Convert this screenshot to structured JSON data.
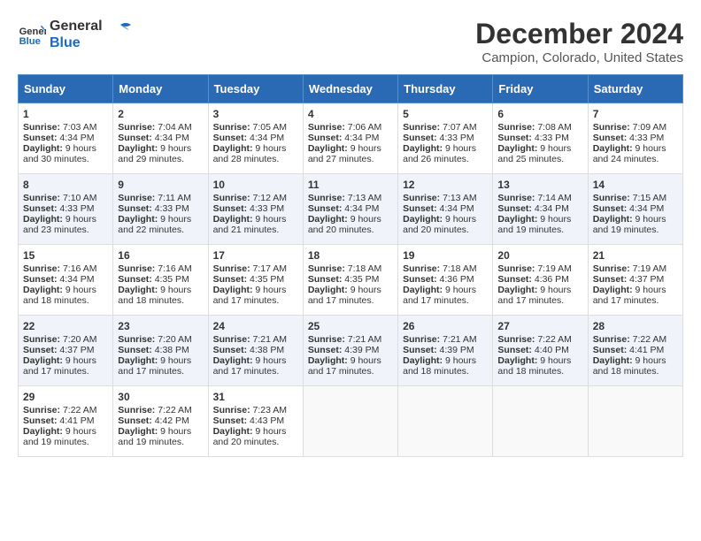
{
  "logo": {
    "line1": "General",
    "line2": "Blue"
  },
  "title": "December 2024",
  "subtitle": "Campion, Colorado, United States",
  "weekdays": [
    "Sunday",
    "Monday",
    "Tuesday",
    "Wednesday",
    "Thursday",
    "Friday",
    "Saturday"
  ],
  "weeks": [
    [
      {
        "day": 1,
        "sunrise": "7:03 AM",
        "sunset": "4:34 PM",
        "daylight": "9 hours and 30 minutes."
      },
      {
        "day": 2,
        "sunrise": "7:04 AM",
        "sunset": "4:34 PM",
        "daylight": "9 hours and 29 minutes."
      },
      {
        "day": 3,
        "sunrise": "7:05 AM",
        "sunset": "4:34 PM",
        "daylight": "9 hours and 28 minutes."
      },
      {
        "day": 4,
        "sunrise": "7:06 AM",
        "sunset": "4:34 PM",
        "daylight": "9 hours and 27 minutes."
      },
      {
        "day": 5,
        "sunrise": "7:07 AM",
        "sunset": "4:33 PM",
        "daylight": "9 hours and 26 minutes."
      },
      {
        "day": 6,
        "sunrise": "7:08 AM",
        "sunset": "4:33 PM",
        "daylight": "9 hours and 25 minutes."
      },
      {
        "day": 7,
        "sunrise": "7:09 AM",
        "sunset": "4:33 PM",
        "daylight": "9 hours and 24 minutes."
      }
    ],
    [
      {
        "day": 8,
        "sunrise": "7:10 AM",
        "sunset": "4:33 PM",
        "daylight": "9 hours and 23 minutes."
      },
      {
        "day": 9,
        "sunrise": "7:11 AM",
        "sunset": "4:33 PM",
        "daylight": "9 hours and 22 minutes."
      },
      {
        "day": 10,
        "sunrise": "7:12 AM",
        "sunset": "4:33 PM",
        "daylight": "9 hours and 21 minutes."
      },
      {
        "day": 11,
        "sunrise": "7:13 AM",
        "sunset": "4:34 PM",
        "daylight": "9 hours and 20 minutes."
      },
      {
        "day": 12,
        "sunrise": "7:13 AM",
        "sunset": "4:34 PM",
        "daylight": "9 hours and 20 minutes."
      },
      {
        "day": 13,
        "sunrise": "7:14 AM",
        "sunset": "4:34 PM",
        "daylight": "9 hours and 19 minutes."
      },
      {
        "day": 14,
        "sunrise": "7:15 AM",
        "sunset": "4:34 PM",
        "daylight": "9 hours and 19 minutes."
      }
    ],
    [
      {
        "day": 15,
        "sunrise": "7:16 AM",
        "sunset": "4:34 PM",
        "daylight": "9 hours and 18 minutes."
      },
      {
        "day": 16,
        "sunrise": "7:16 AM",
        "sunset": "4:35 PM",
        "daylight": "9 hours and 18 minutes."
      },
      {
        "day": 17,
        "sunrise": "7:17 AM",
        "sunset": "4:35 PM",
        "daylight": "9 hours and 17 minutes."
      },
      {
        "day": 18,
        "sunrise": "7:18 AM",
        "sunset": "4:35 PM",
        "daylight": "9 hours and 17 minutes."
      },
      {
        "day": 19,
        "sunrise": "7:18 AM",
        "sunset": "4:36 PM",
        "daylight": "9 hours and 17 minutes."
      },
      {
        "day": 20,
        "sunrise": "7:19 AM",
        "sunset": "4:36 PM",
        "daylight": "9 hours and 17 minutes."
      },
      {
        "day": 21,
        "sunrise": "7:19 AM",
        "sunset": "4:37 PM",
        "daylight": "9 hours and 17 minutes."
      }
    ],
    [
      {
        "day": 22,
        "sunrise": "7:20 AM",
        "sunset": "4:37 PM",
        "daylight": "9 hours and 17 minutes."
      },
      {
        "day": 23,
        "sunrise": "7:20 AM",
        "sunset": "4:38 PM",
        "daylight": "9 hours and 17 minutes."
      },
      {
        "day": 24,
        "sunrise": "7:21 AM",
        "sunset": "4:38 PM",
        "daylight": "9 hours and 17 minutes."
      },
      {
        "day": 25,
        "sunrise": "7:21 AM",
        "sunset": "4:39 PM",
        "daylight": "9 hours and 17 minutes."
      },
      {
        "day": 26,
        "sunrise": "7:21 AM",
        "sunset": "4:39 PM",
        "daylight": "9 hours and 18 minutes."
      },
      {
        "day": 27,
        "sunrise": "7:22 AM",
        "sunset": "4:40 PM",
        "daylight": "9 hours and 18 minutes."
      },
      {
        "day": 28,
        "sunrise": "7:22 AM",
        "sunset": "4:41 PM",
        "daylight": "9 hours and 18 minutes."
      }
    ],
    [
      {
        "day": 29,
        "sunrise": "7:22 AM",
        "sunset": "4:41 PM",
        "daylight": "9 hours and 19 minutes."
      },
      {
        "day": 30,
        "sunrise": "7:22 AM",
        "sunset": "4:42 PM",
        "daylight": "9 hours and 19 minutes."
      },
      {
        "day": 31,
        "sunrise": "7:23 AM",
        "sunset": "4:43 PM",
        "daylight": "9 hours and 20 minutes."
      },
      null,
      null,
      null,
      null
    ]
  ],
  "labels": {
    "sunrise": "Sunrise: ",
    "sunset": "Sunset: ",
    "daylight": "Daylight: "
  }
}
